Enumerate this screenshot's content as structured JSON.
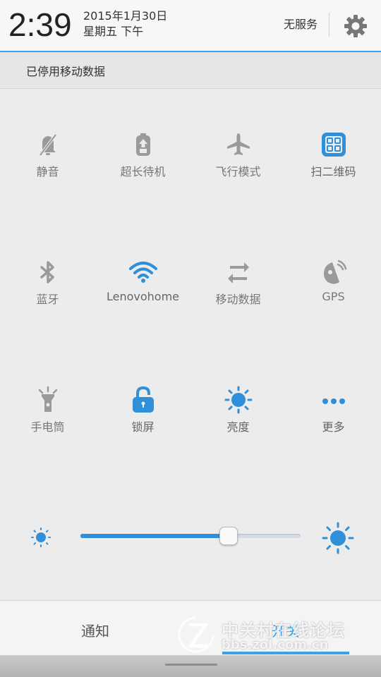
{
  "status": {
    "time": "2:39",
    "date": "2015年1月30日",
    "weekday": "星期五 下午",
    "service": "无服务",
    "settings_icon": "gear-icon"
  },
  "notice": {
    "text": "已停用移动数据"
  },
  "toggles": [
    {
      "label": "静音",
      "icon": "mute-bell-icon",
      "active": false
    },
    {
      "label": "超长待机",
      "icon": "long-standby-icon",
      "active": false
    },
    {
      "label": "飞行模式",
      "icon": "airplane-icon",
      "active": false
    },
    {
      "label": "扫二维码",
      "icon": "qr-scan-icon",
      "active": true
    },
    {
      "label": "蓝牙",
      "icon": "bluetooth-icon",
      "active": false
    },
    {
      "label": "Lenovohome",
      "icon": "wifi-icon",
      "active": true
    },
    {
      "label": "移动数据",
      "icon": "mobile-data-icon",
      "active": false
    },
    {
      "label": "GPS",
      "icon": "gps-icon",
      "active": false
    },
    {
      "label": "手电筒",
      "icon": "flashlight-icon",
      "active": false
    },
    {
      "label": "锁屏",
      "icon": "lock-icon",
      "active": true
    },
    {
      "label": "亮度",
      "icon": "brightness-icon",
      "active": true
    },
    {
      "label": "更多",
      "icon": "more-icon",
      "active": true
    }
  ],
  "brightness": {
    "level": 0.67
  },
  "tabs": [
    {
      "label": "通知",
      "active": false
    },
    {
      "label": "开关",
      "active": true
    }
  ],
  "watermark": {
    "name": "中关村在线论坛",
    "url": "bbs.zol.com.cn"
  },
  "colors": {
    "accent": "#2f8fd8",
    "inactive": "#9a9a9a",
    "background": "#ececec"
  }
}
